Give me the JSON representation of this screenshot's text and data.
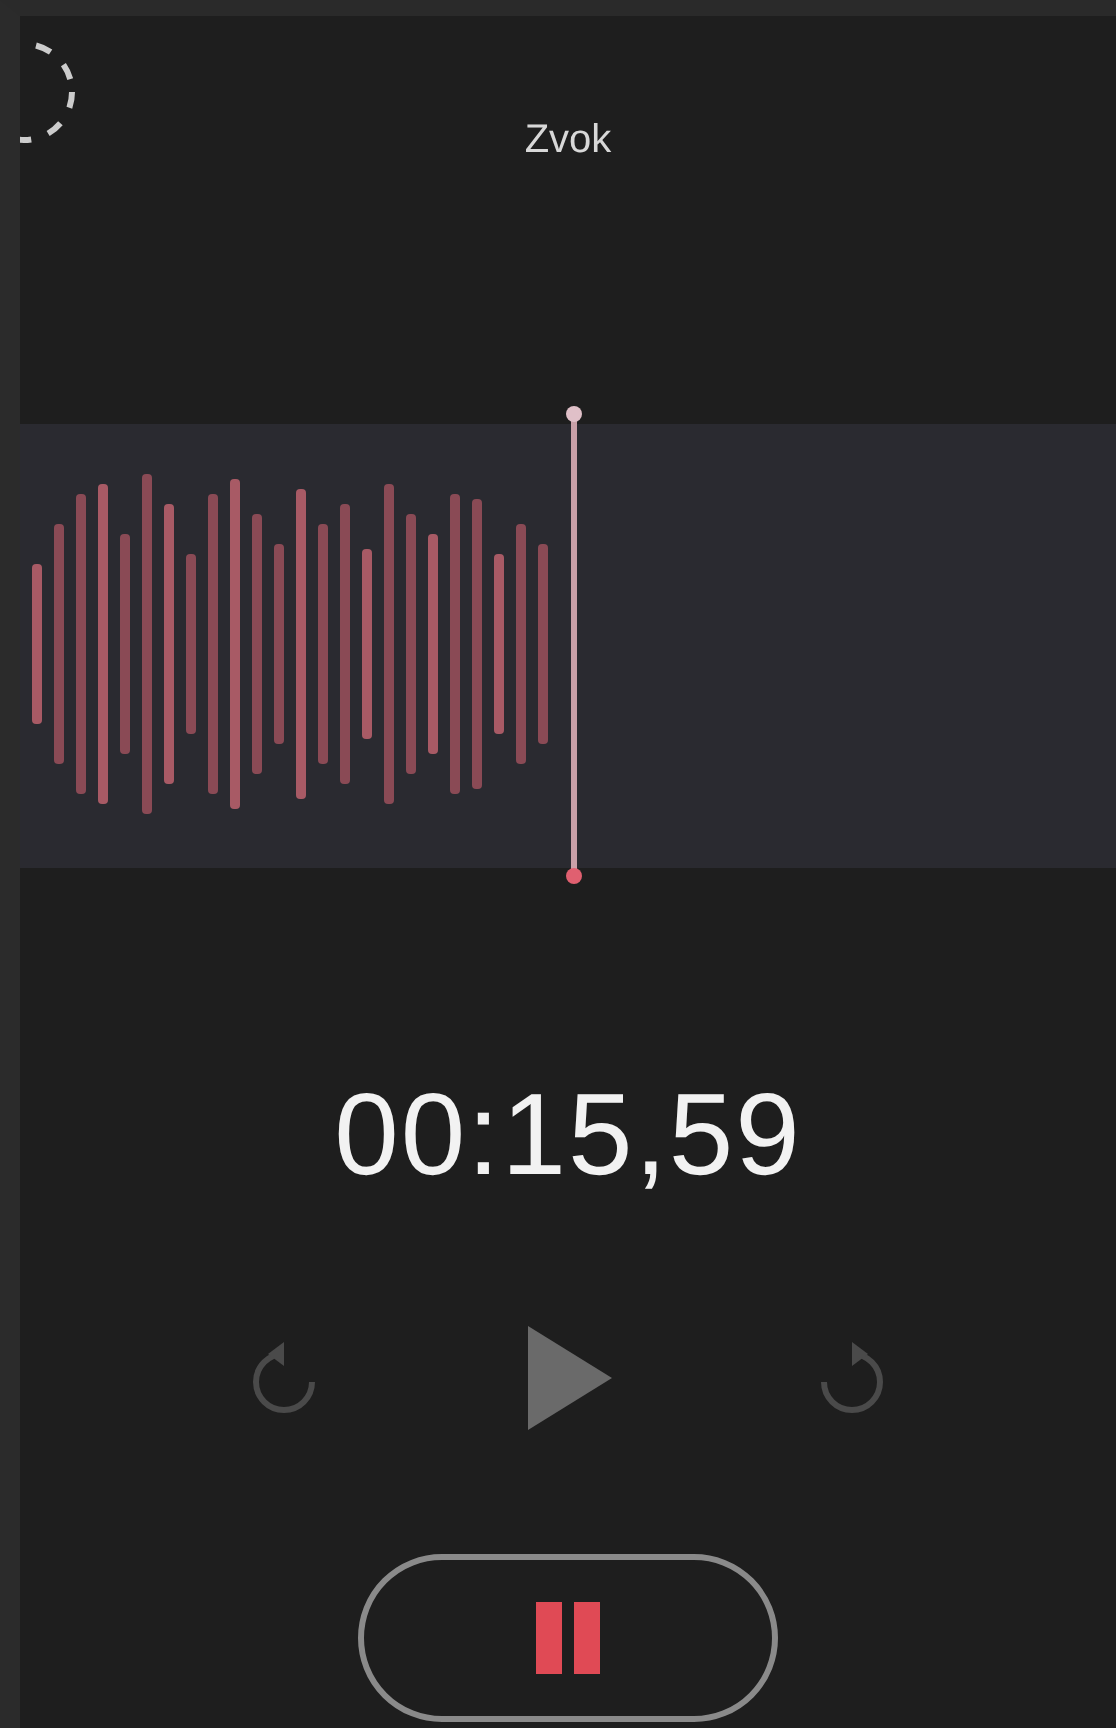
{
  "recording": {
    "title": "Zvok"
  },
  "timer": "00:15,59",
  "record_button": {
    "recording": true
  }
}
